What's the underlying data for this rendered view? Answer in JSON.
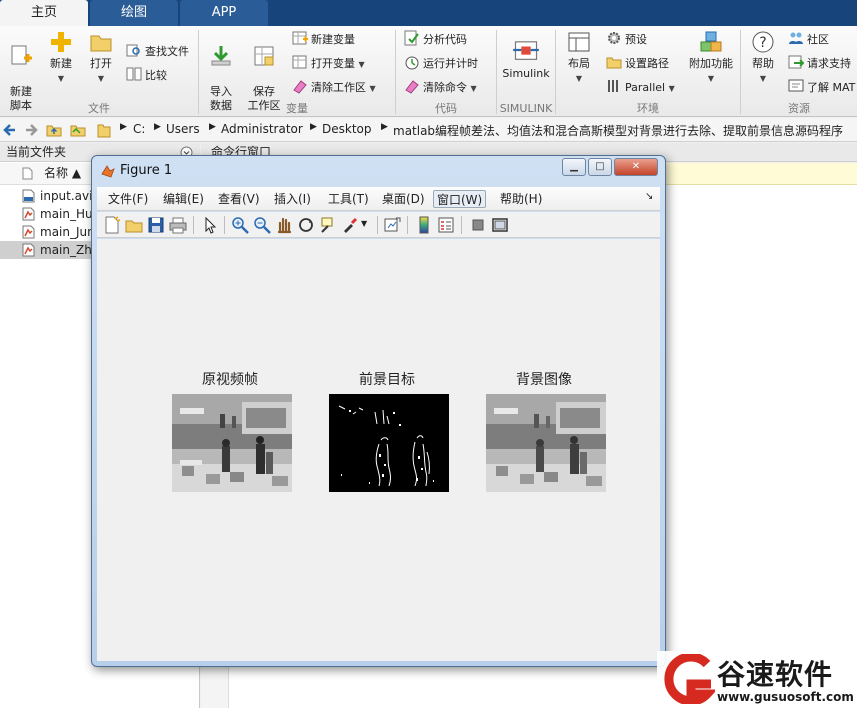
{
  "tabs": [
    {
      "label": "主页",
      "active": true
    },
    {
      "label": "绘图",
      "active": false
    },
    {
      "label": "APP",
      "active": false
    }
  ],
  "ribbon": {
    "file_section": {
      "label": "文件",
      "new_script": "新建\n脚本",
      "new": "新建",
      "open": "打开",
      "find_files": "查找文件",
      "compare": "比较"
    },
    "variable_section": {
      "label": "变量",
      "import_data": "导入\n数据",
      "save_workspace": "保存\n工作区",
      "new_variable": "新建变量",
      "open_variable": "打开变量",
      "clear_workspace": "清除工作区"
    },
    "code_section": {
      "label": "代码",
      "analyze_code": "分析代码",
      "run_and_time": "运行并计时",
      "clear_commands": "清除命令"
    },
    "simulink_section": {
      "label": "SIMULINK",
      "simulink": "Simulink"
    },
    "environment_section": {
      "label": "环境",
      "layout": "布局",
      "preferences": "预设",
      "set_path": "设置路径",
      "parallel": "Parallel",
      "add_ons": "附加功能"
    },
    "resources_section": {
      "label": "资源",
      "help": "帮助",
      "community": "社区",
      "request_support": "请求支持",
      "learn_matlab": "了解 MAT"
    }
  },
  "address": {
    "crumbs": [
      "C:",
      "Users",
      "Administrator",
      "Desktop",
      "matlab编程帧差法、均值法和混合高斯模型对背景进行去除、提取前景信息源码程序"
    ]
  },
  "left_panel": {
    "title": "当前文件夹",
    "column_name": "名称 ▲",
    "files": [
      {
        "name": "input.avi",
        "type": "avi",
        "selected": false
      },
      {
        "name": "main_Hun",
        "type": "m",
        "selected": false
      },
      {
        "name": "main_Jun",
        "type": "m",
        "selected": false
      },
      {
        "name": "main_Zhe",
        "type": "m",
        "selected": true
      }
    ]
  },
  "command_window": {
    "title": "命令行窗口"
  },
  "figure": {
    "title": "Figure 1",
    "menus": [
      "文件(F)",
      "编辑(E)",
      "查看(V)",
      "插入(I)",
      "工具(T)",
      "桌面(D)",
      "窗口(W)",
      "帮助(H)"
    ],
    "selected_menu": "窗口(W)",
    "subplots": [
      {
        "title": "原视频帧",
        "kind": "original"
      },
      {
        "title": "前景目标",
        "kind": "foreground"
      },
      {
        "title": "背景图像",
        "kind": "background"
      }
    ]
  },
  "watermark": {
    "brand": "谷速软件",
    "url": "www.gusuosoft.com"
  },
  "colors": {
    "tabbar": "#17447a",
    "accent_blue": "#2a5d97",
    "watermark_red": "#d62a20"
  }
}
